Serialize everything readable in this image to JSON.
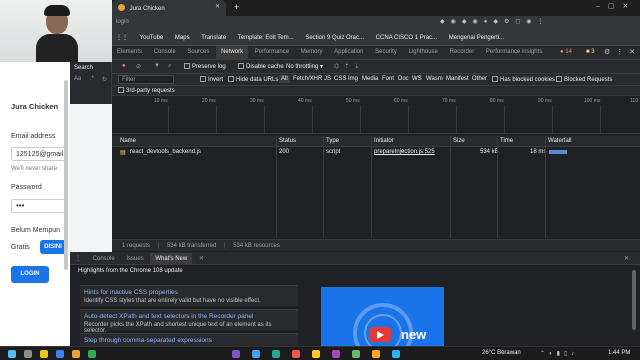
{
  "search_label": "Search",
  "login_page": {
    "brand": "Jura Chicken",
    "email_label": "Email address",
    "email_value": "125125@gmail",
    "email_hint": "We'll never share",
    "password_label": "Password",
    "password_value": "•••",
    "remember_text": "Belum Mempun",
    "signup_text": "Gratis",
    "signup_button": "DISINI",
    "login_button": "LOGIN"
  },
  "browser": {
    "tab_title": "Jura Chicken",
    "url": "login",
    "bookmarks": [
      "YouTube",
      "Maps",
      "Translate",
      "Template: Edit Tem...",
      "Section 9 Quiz Orac...",
      "CCNA CISCO 1 Prac...",
      "Mengenai Pengerti..."
    ]
  },
  "devtools": {
    "tabs": [
      "Elements",
      "Console",
      "Sources",
      "Network",
      "Performance",
      "Memory",
      "Application",
      "Security",
      "Lighthouse",
      "Recorder",
      "Performance insights"
    ],
    "active_tab": "Network",
    "badges": {
      "errors": "14",
      "warnings": "3"
    },
    "toolbar": {
      "preserve_log": "Preserve log",
      "disable_cache": "Disable cache",
      "throttling": "No throttling"
    },
    "filter": {
      "placeholder": "Filter",
      "invert": "Invert",
      "hide_data_urls": "Hide data URLs",
      "types": [
        "All",
        "Fetch/XHR",
        "JS",
        "CSS",
        "Img",
        "Media",
        "Font",
        "Doc",
        "WS",
        "Wasm",
        "Manifest",
        "Other"
      ],
      "blocked_cookies": "Has blocked cookies",
      "blocked_requests": "Blocked Requests",
      "third_party": "3rd-party requests"
    },
    "timeline_ticks": [
      "10 ms",
      "20 ms",
      "30 ms",
      "40 ms",
      "50 ms",
      "60 ms",
      "70 ms",
      "80 ms",
      "90 ms",
      "100 ms",
      "110"
    ],
    "columns": [
      "Name",
      "Status",
      "Type",
      "Initiator",
      "Size",
      "Time",
      "Waterfall"
    ],
    "rows": [
      {
        "name": "react_devtools_backend.js",
        "status": "200",
        "type": "script",
        "initiator": "prepareInjection.js:525",
        "size": "534 kB",
        "time": "18 ms"
      }
    ],
    "status_bar": [
      "1 requests",
      "534 kB transferred",
      "534 kB resources"
    ],
    "drawer_tabs": [
      "Console",
      "Issues",
      "What's New"
    ],
    "drawer_active": "What's New",
    "highlights": "Highlights from the Chrome 108 update",
    "cards": [
      {
        "title": "Hints for inactive CSS properties",
        "desc": "Identify CSS styles that are entirely valid but have no visible effect."
      },
      {
        "title": "Auto-detect XPath and text selectors in the Recorder panel",
        "desc": "Recorder picks the XPath and shortest unique text of an element as its selector."
      },
      {
        "title": "Step through comma-separated expressions",
        "desc": ""
      }
    ],
    "video_text": "new"
  },
  "taskbar": {
    "weather": "26°C  Berawan",
    "time": "1:44 PM"
  }
}
